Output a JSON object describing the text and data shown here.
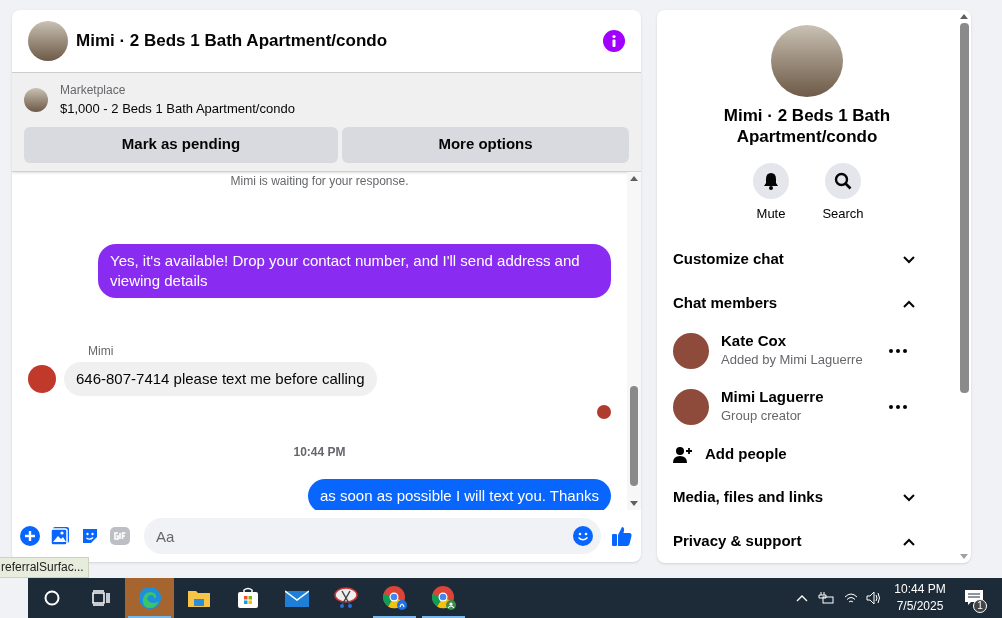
{
  "chat": {
    "title": "Mimi · 2 Beds 1 Bath Apartment/condo",
    "listing": {
      "source": "Marketplace",
      "summary": "$1,000 - 2 Beds 1 Bath Apartment/condo"
    },
    "actions": [
      "Mark as pending",
      "More options"
    ],
    "messages": [
      {
        "kind": "notice",
        "text": "Mimi is waiting for your response."
      },
      {
        "kind": "outgoing",
        "text": "Yes, it's available! Drop your contact number, and I'll send address and viewing details",
        "color": "#8a2bf2"
      },
      {
        "kind": "incoming",
        "sender": "Mimi",
        "text": "646-807-7414 please text me before calling"
      },
      {
        "kind": "seen"
      },
      {
        "kind": "time",
        "text": "10:44 PM"
      },
      {
        "kind": "outgoing",
        "text": "as soon as possible I will text you. Thanks",
        "color": "#0866ff"
      }
    ],
    "composer": {
      "placeholder": "Aa"
    }
  },
  "details": {
    "title": "Mimi · 2 Beds 1 Bath Apartment/condo",
    "actions": [
      {
        "kind": "mute",
        "label": "Mute"
      },
      {
        "kind": "search",
        "label": "Search"
      }
    ],
    "sections": [
      {
        "label": "Customize chat",
        "expanded": false
      },
      {
        "label": "Chat members",
        "expanded": true,
        "members": [
          {
            "name": "Kate Cox",
            "role": "Added by Mimi Laguerre"
          },
          {
            "name": "Mimi Laguerre",
            "role": "Group creator"
          }
        ],
        "add_label": "Add people"
      },
      {
        "label": "Media, files and links",
        "expanded": false
      },
      {
        "label": "Privacy & support",
        "expanded": true
      }
    ]
  },
  "status_tooltip": "referralSurfac...",
  "taskbar": {
    "apps": [
      {
        "kind": "taskview",
        "selected": false,
        "running": false
      },
      {
        "kind": "edge",
        "selected": true,
        "running": true
      },
      {
        "kind": "files",
        "selected": false,
        "running": false
      },
      {
        "kind": "store",
        "selected": false,
        "running": false
      },
      {
        "kind": "mail",
        "selected": false,
        "running": false
      },
      {
        "kind": "snip",
        "selected": false,
        "running": false
      },
      {
        "kind": "chrome",
        "selected": false,
        "running": true
      },
      {
        "kind": "chrome-profile",
        "selected": false,
        "running": true
      }
    ],
    "time": "10:44 PM",
    "date": "7/5/2025",
    "notification_count": "1"
  }
}
